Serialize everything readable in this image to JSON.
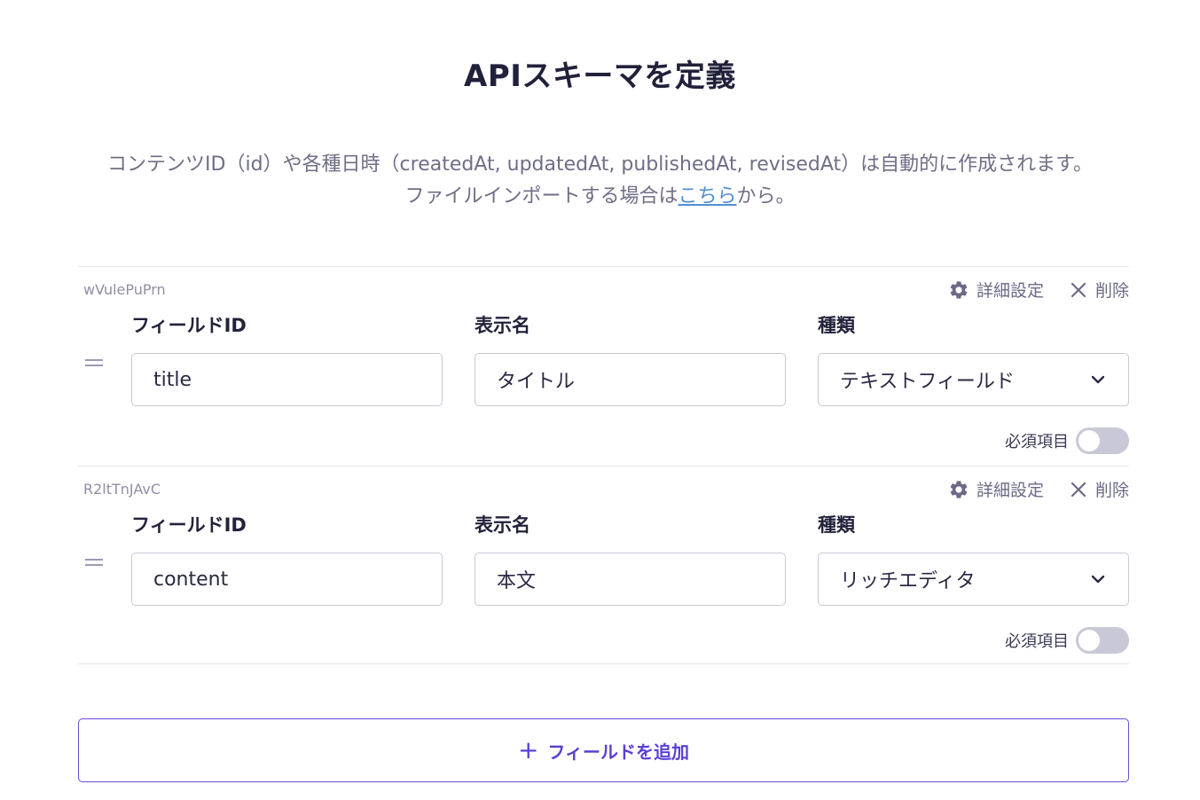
{
  "page": {
    "title": "APIスキーマを定義",
    "description_line1": "コンテンツID（id）や各種日時（createdAt, updatedAt, publishedAt, revisedAt）は自動的に作成されます。",
    "description_line2_prefix": "ファイルインポートする場合は",
    "description_link": "こちら",
    "description_line2_suffix": "から。"
  },
  "fields": [
    {
      "row_id": "wVulePuPrn",
      "settings_label": "詳細設定",
      "delete_label": "削除",
      "field_id_label": "フィールドID",
      "field_id_value": "title",
      "display_name_label": "表示名",
      "display_name_value": "タイトル",
      "type_label": "種類",
      "type_value": "テキストフィールド",
      "required_label": "必須項目",
      "required": false
    },
    {
      "row_id": "R2ltTnJAvC",
      "settings_label": "詳細設定",
      "delete_label": "削除",
      "field_id_label": "フィールドID",
      "field_id_value": "content",
      "display_name_label": "表示名",
      "display_name_value": "本文",
      "type_label": "種類",
      "type_value": "リッチエディタ",
      "required_label": "必須項目",
      "required": false
    }
  ],
  "add_field": {
    "icon": "plus-icon",
    "label": "フィールドを追加"
  },
  "colors": {
    "accent": "#5b3fd4",
    "link": "#4f8ed6",
    "toggle_off": "#c8c8d6"
  }
}
